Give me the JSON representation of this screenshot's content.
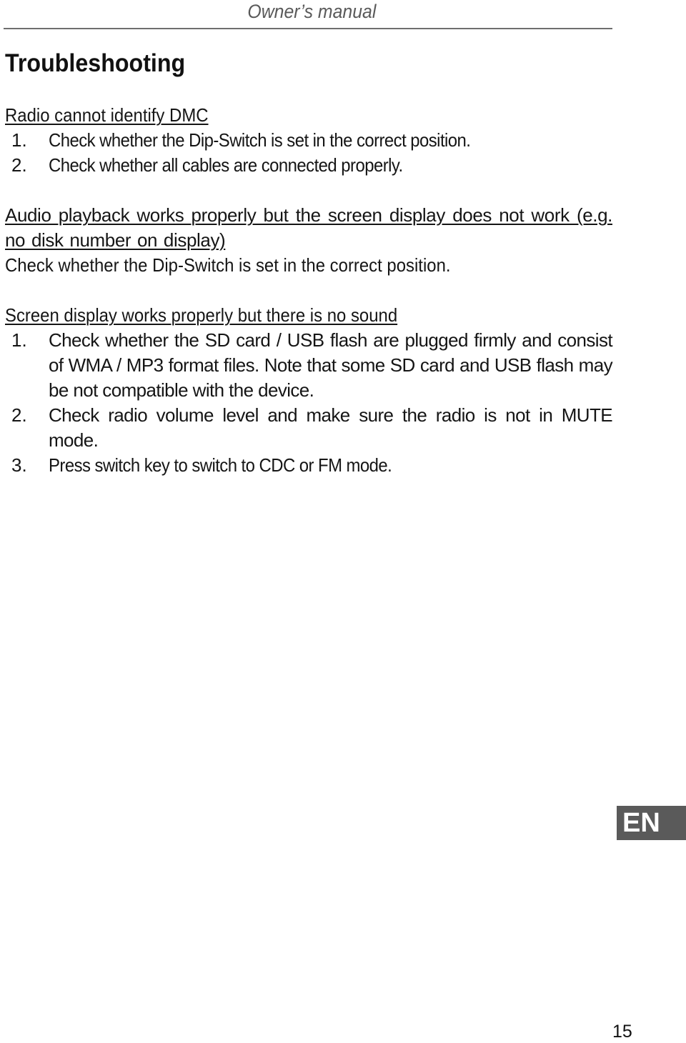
{
  "header": {
    "title": "Owner’s manual"
  },
  "page_title": "Troubleshooting",
  "sections": [
    {
      "heading": "Radio cannot identify DMC",
      "items": [
        {
          "num": "1.",
          "text": "Check whether the Dip-Switch is set in the correct position."
        },
        {
          "num": "2.",
          "text": "Check whether all cables are connected properly."
        }
      ]
    },
    {
      "heading": "Audio playback works properly but the screen display does not work (e.g. no disk number on display)",
      "text": "Check whether the Dip-Switch is set in the correct position."
    },
    {
      "heading": "Screen display works properly but there is no sound",
      "items": [
        {
          "num": "1.",
          "text": "Check whether the SD card / USB flash are plugged firmly and consist of WMA / MP3 format files. Note that some SD card and USB flash may be not compatible with the device."
        },
        {
          "num": "2.",
          "text": "Check radio volume level and make sure the radio is not in MUTE mode."
        },
        {
          "num": "3.",
          "text": "Press switch key to switch to CDC or FM mode."
        }
      ]
    }
  ],
  "language_badge": "EN",
  "page_number": "15",
  "colors": {
    "badge_bg": "#5a5a5a",
    "header_text": "#595959",
    "rule": "#6e6e6e"
  }
}
